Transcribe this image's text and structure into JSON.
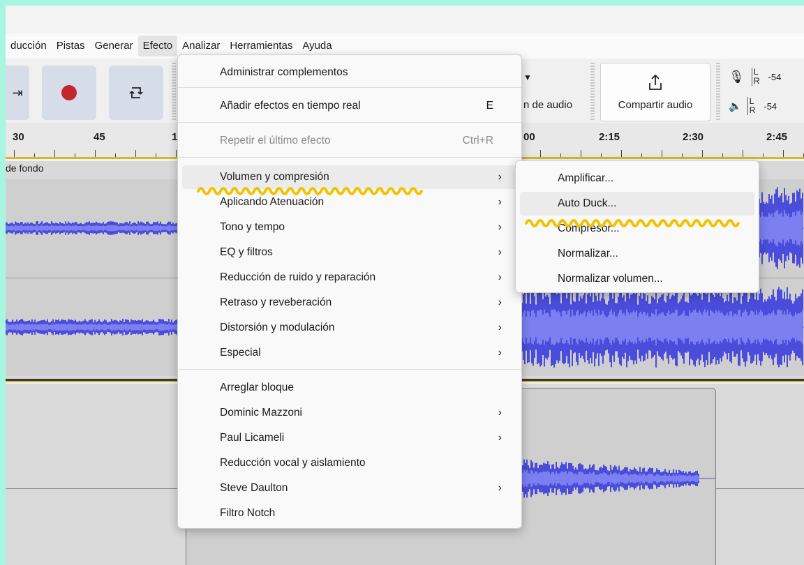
{
  "menubar": {
    "items": [
      "ducción",
      "Pistas",
      "Generar",
      "Efecto",
      "Analizar",
      "Herramientas",
      "Ayuda"
    ],
    "active": "Efecto"
  },
  "toolbar": {
    "audio_setup_partial": "n de audio",
    "share_label": "Compartir audio",
    "meter_record": {
      "l": "L",
      "r": "R",
      "db": "-54"
    },
    "meter_play": {
      "l": "L",
      "r": "R",
      "db": "-54"
    }
  },
  "ruler": {
    "labels": [
      "30",
      "45",
      "1",
      "00",
      "2:15",
      "2:30",
      "2:45"
    ]
  },
  "tracks": {
    "track1_name": "de fondo"
  },
  "effect_menu": {
    "items": [
      {
        "label": "Administrar complementos",
        "shortcut": "",
        "submenu": false,
        "disabled": false,
        "highlight": false
      },
      {
        "label": "Añadir efectos en tiempo real",
        "shortcut": "E",
        "submenu": false,
        "disabled": false,
        "highlight": false
      },
      {
        "label": "Repetir el último efecto",
        "shortcut": "Ctrl+R",
        "submenu": false,
        "disabled": true,
        "highlight": false
      },
      {
        "label": "Volumen y compresión",
        "shortcut": "",
        "submenu": true,
        "disabled": false,
        "highlight": true
      },
      {
        "label": "Aplicando Atenuación",
        "shortcut": "",
        "submenu": true,
        "disabled": false,
        "highlight": false
      },
      {
        "label": "Tono y tempo",
        "shortcut": "",
        "submenu": true,
        "disabled": false,
        "highlight": false
      },
      {
        "label": "EQ y filtros",
        "shortcut": "",
        "submenu": true,
        "disabled": false,
        "highlight": false
      },
      {
        "label": "Reducción de ruido y reparación",
        "shortcut": "",
        "submenu": true,
        "disabled": false,
        "highlight": false
      },
      {
        "label": "Retraso y reveberación",
        "shortcut": "",
        "submenu": true,
        "disabled": false,
        "highlight": false
      },
      {
        "label": "Distorsión y modulación",
        "shortcut": "",
        "submenu": true,
        "disabled": false,
        "highlight": false
      },
      {
        "label": "Especial",
        "shortcut": "",
        "submenu": true,
        "disabled": false,
        "highlight": false
      },
      {
        "label": "Arreglar bloque",
        "shortcut": "",
        "submenu": false,
        "disabled": false,
        "highlight": false
      },
      {
        "label": "Dominic Mazzoni",
        "shortcut": "",
        "submenu": true,
        "disabled": false,
        "highlight": false
      },
      {
        "label": "Paul Licameli",
        "shortcut": "",
        "submenu": true,
        "disabled": false,
        "highlight": false
      },
      {
        "label": "Reducción vocal y aislamiento",
        "shortcut": "",
        "submenu": false,
        "disabled": false,
        "highlight": false
      },
      {
        "label": "Steve Daulton",
        "shortcut": "",
        "submenu": true,
        "disabled": false,
        "highlight": false
      },
      {
        "label": "Filtro Notch",
        "shortcut": "",
        "submenu": false,
        "disabled": false,
        "highlight": false
      }
    ]
  },
  "volume_submenu": {
    "items": [
      {
        "label": "Amplificar...",
        "highlight": false
      },
      {
        "label": "Auto Duck...",
        "highlight": true
      },
      {
        "label": "Compresor...",
        "highlight": false
      },
      {
        "label": "Normalizar...",
        "highlight": false
      },
      {
        "label": "Normalizar volumen...",
        "highlight": false
      }
    ]
  },
  "colors": {
    "frame": "#a8f5e0",
    "waveform": "#4a4ddb",
    "waveform_light": "#7b7ff0",
    "highlight_squiggle": "#f2c200",
    "record": "#c0282d",
    "ruler_border": "#d8b62a"
  }
}
